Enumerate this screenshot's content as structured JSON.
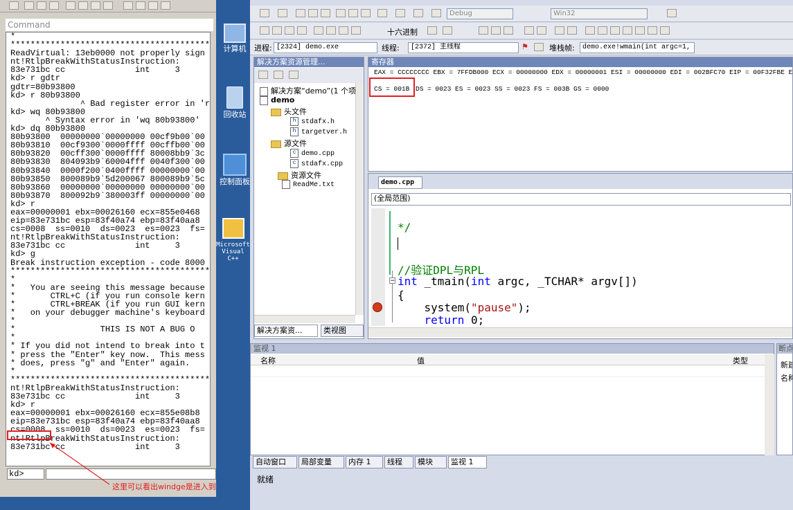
{
  "windbg": {
    "command_title": "Command",
    "output_lines": [
      "*",
      "*********************************************",
      "ReadVirtual: 13eb0000 not properly sign",
      "nt!RtlpBreakWithStatusInstruction:",
      "83e731bc cc              int     3",
      "kd> r gdtr",
      "gdtr=80b93800",
      "kd> r 80b93800",
      "              ^ Bad register error in 'r",
      "kd> wq 80b93800",
      "       ^ Syntax error in 'wq 80b93800'",
      "kd> dq 80b93800",
      "80b93800  00000000`00000000 00cf9b00`00",
      "80b93810  00cf9300`0000ffff 00cffb00`00",
      "80b93820  00cff300`0000ffff 80008bb9`3c",
      "80b93830  804093b9`60004fff 0040f300`00",
      "80b93840  0000f200`0400ffff 00000000`00",
      "80b93850  800089b9`5d200067 800089b9`5c",
      "80b93860  00000000`00000000 00000000`00",
      "80b93870  800092b9`380003ff 00000000`00",
      "kd> r",
      "eax=00000001 ebx=00026160 ecx=855e0468",
      "eip=83e731bc esp=83f40a74 ebp=83f40aa8",
      "cs=0008  ss=0010  ds=0023  es=0023  fs=",
      "nt!RtlpBreakWithStatusInstruction:",
      "83e731bc cc              int     3",
      "kd> g",
      "Break instruction exception - code 8000",
      "*********************************************",
      "*",
      "*   You are seeing this message because",
      "*       CTRL+C (if you run console kern",
      "*       CTRL+BREAK (if you run GUI kern",
      "*   on your debugger machine's keyboard",
      "*",
      "*                 THIS IS NOT A BUG O",
      "*",
      "* If you did not intend to break into t",
      "* press the \"Enter\" key now.  This mess",
      "* does, press \"g\" and \"Enter\" again.",
      "*",
      "*********************************************",
      "nt!RtlpBreakWithStatusInstruction:",
      "83e731bc cc              int     3",
      "kd> r",
      "eax=00000001 ebx=00026160 ecx=855e08b8",
      "eip=83e731bc esp=83f40a74 ebp=83f40aa8",
      "cs=0008  ss=0010  ds=0023  es=0023  fs=",
      "nt!RtlpBreakWithStatusInstruction:",
      "83e731bc cc              int     3"
    ],
    "prompt": "kd>",
    "annotation": "这里可以看出windge是进入到"
  },
  "desktop": {
    "icons": [
      {
        "label": "计算机",
        "icon": "computer-icon"
      },
      {
        "label": "回收站",
        "icon": "recycle-bin-icon"
      },
      {
        "label": "控制面板",
        "icon": "control-panel-icon"
      },
      {
        "label": "Microsoft Visual C++",
        "icon": "visual-cpp-icon"
      }
    ]
  },
  "vs": {
    "toolbar": {
      "config": "Debug",
      "platform": "Win32",
      "hex_label": "十六进制"
    },
    "debug_location": {
      "process_label": "进程:",
      "process_value": "[2324] demo.exe",
      "thread_label": "线程:",
      "thread_value": "[2372] 主线程",
      "stack_label": "堆栈帧:",
      "stack_value": "demo.exe!wmain(int argc=1, wc"
    },
    "solution_explorer": {
      "title": "解决方案资源管理...",
      "solution": "解决方案“demo”(1 个项目",
      "project": "demo",
      "header_folder": "头文件",
      "files_header": [
        "stdafx.h",
        "targetver.h"
      ],
      "source_folder": "源文件",
      "files_source": [
        "demo.cpp",
        "stdafx.cpp"
      ],
      "resource_folder": "资源文件",
      "readme": "ReadMe.txt",
      "tab_solution": "解决方案资...",
      "tab_class": "类视图"
    },
    "registers": {
      "title": "寄存器",
      "line1": "EAX = CCCCCCCC EBX = 7FFDB000 ECX = 00000000 EDX = 00000001 ESI = 00000000 EDI = 002BFC70 EIP = 00F32FBE ESP",
      "cs": "CS = 001B",
      "line2_rest": "DS = 0023 ES = 0023 SS = 0023 FS = 003B GS = 0000"
    },
    "editor": {
      "tab": "demo.cpp",
      "scope": "(全局范围)",
      "lines": [
        "*/",
        "",
        "//验证DPL与RPL",
        "int _tmain(int argc, _TCHAR* argv[])",
        "{",
        "    system(\"pause\");",
        "    return 0;"
      ]
    },
    "watch": {
      "title": "监视 1",
      "col_name": "名称",
      "col_value": "值",
      "col_type": "类型"
    },
    "breakpoints": {
      "title": "断点",
      "new": "新建",
      "col_name": "名称"
    },
    "bottom_tabs": [
      "自动窗口",
      "局部变量",
      "内存 1",
      "线程",
      "模块",
      "监视 1"
    ],
    "status": "就绪"
  }
}
